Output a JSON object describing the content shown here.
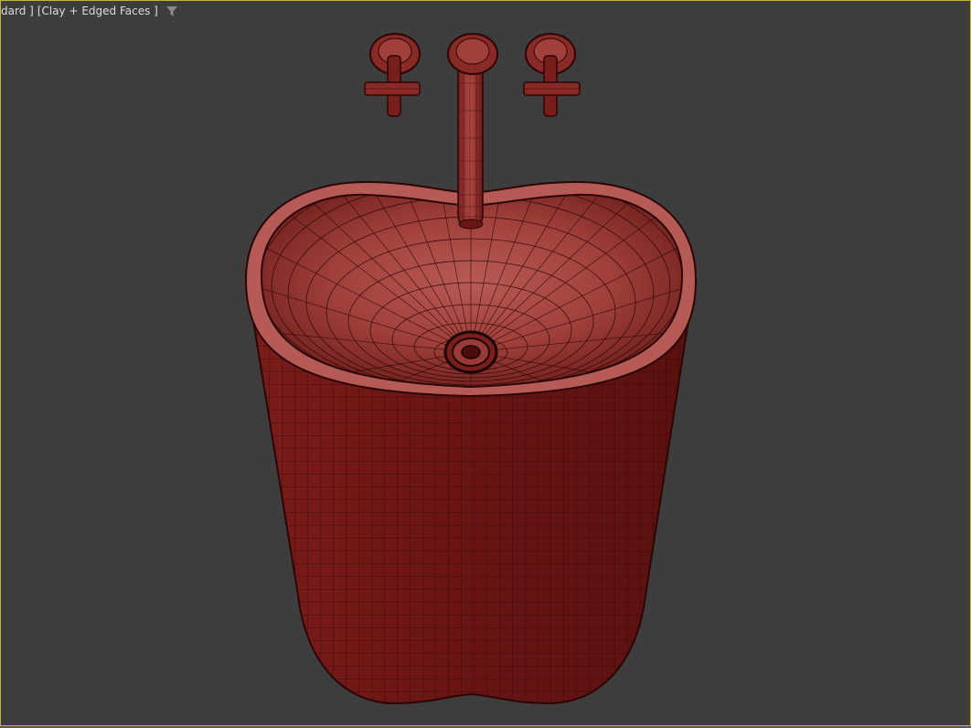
{
  "viewport": {
    "label_prefix": "dard ]",
    "label_shading": "[Clay + Edged Faces ]",
    "filter_icon": "filter-icon",
    "border_color": "#c8b43a",
    "background_color": "#3d3d3d"
  },
  "scene": {
    "object": "pedestal-washbasin-with-wall-faucet",
    "material_color": "#8a2020",
    "wire_color": "#2a0606"
  }
}
